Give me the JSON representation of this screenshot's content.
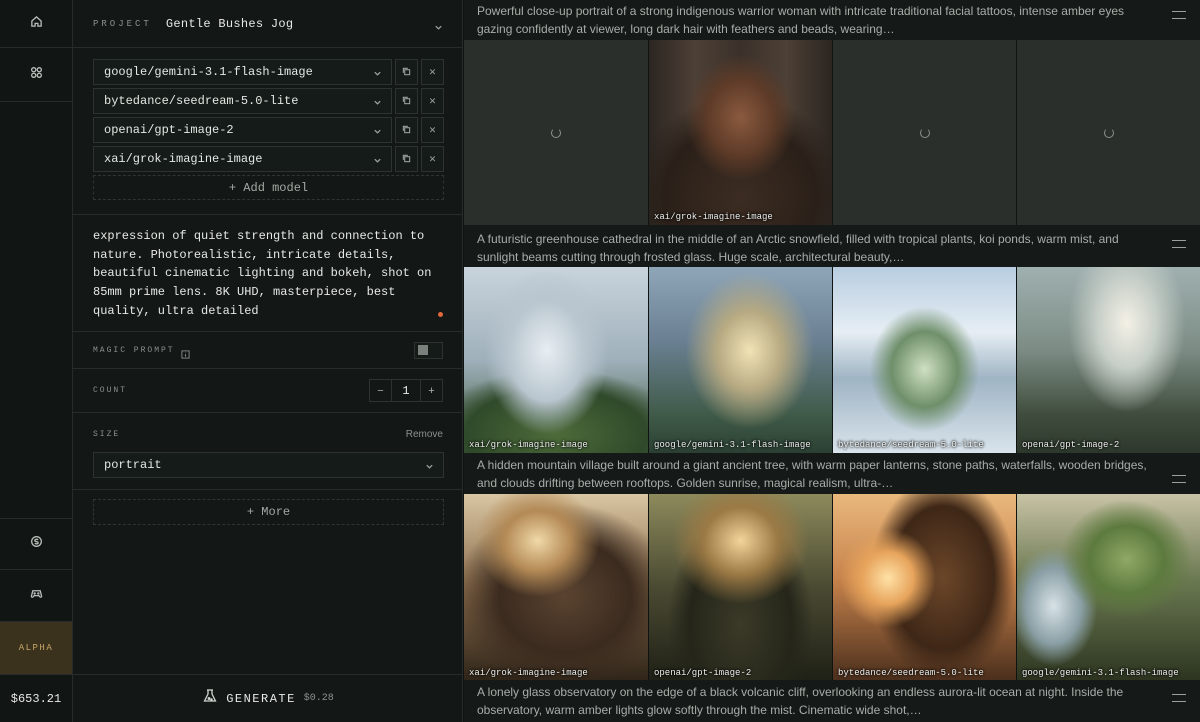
{
  "rail": {
    "alpha_label": "ALPHA",
    "balance": "$653.21",
    "icons": [
      "home-icon",
      "grid-icon",
      "coin-icon",
      "gamepad-icon"
    ]
  },
  "project": {
    "label": "PROJECT",
    "name": "Gentle Bushes Jog"
  },
  "models": [
    {
      "name": "google/gemini-3.1-flash-image"
    },
    {
      "name": "bytedance/seedream-5.0-lite"
    },
    {
      "name": "openai/gpt-image-2"
    },
    {
      "name": "xai/grok-imagine-image"
    }
  ],
  "add_model_label": "+ Add model",
  "prompt_text": "expression of quiet strength and connection to nature. Photorealistic, intricate details, beautiful cinematic lighting and bokeh, shot on 85mm prime lens. 8K UHD, masterpiece, best quality, ultra detailed",
  "magic_prompt": {
    "label": "MAGIC PROMPT",
    "enabled": false
  },
  "count": {
    "label": "COUNT",
    "value": "1",
    "minus": "−",
    "plus": "+"
  },
  "size": {
    "label": "SIZE",
    "remove_label": "Remove",
    "value": "portrait"
  },
  "more_label": "+ More",
  "generate": {
    "label": "GENERATE",
    "cost": "$0.28"
  },
  "colors": {
    "accent_dot": "#e0673a",
    "alpha_bg": "#3a321c",
    "alpha_text": "#c9a86a"
  },
  "gallery": [
    {
      "caption": "Powerful close-up portrait of a strong indigenous warrior woman with intricate traditional facial tattoos, intense amber eyes gazing confidently at viewer, long dark hair with feathers and beads, wearing…",
      "tiles": [
        {
          "status": "loading",
          "model": ""
        },
        {
          "status": "done",
          "model": "xai/grok-imagine-image"
        },
        {
          "status": "loading",
          "model": ""
        },
        {
          "status": "loading",
          "model": ""
        }
      ]
    },
    {
      "caption": "A futuristic greenhouse cathedral in the middle of an Arctic snowfield, filled with tropical plants, koi ponds, warm mist, and sunlight beams cutting through frosted glass. Huge scale, architectural beauty,…",
      "tiles": [
        {
          "status": "done",
          "model": "xai/grok-imagine-image"
        },
        {
          "status": "done",
          "model": "google/gemini-3.1-flash-image"
        },
        {
          "status": "done",
          "model": "bytedance/seedream-5.0-lite"
        },
        {
          "status": "done",
          "model": "openai/gpt-image-2"
        }
      ]
    },
    {
      "caption": "A hidden mountain village built around a giant ancient tree, with warm paper lanterns, stone paths, waterfalls, wooden bridges, and clouds drifting between rooftops. Golden sunrise, magical realism, ultra-…",
      "tiles": [
        {
          "status": "done",
          "model": "xai/grok-imagine-image"
        },
        {
          "status": "done",
          "model": "openai/gpt-image-2"
        },
        {
          "status": "done",
          "model": "bytedance/seedream-5.0-lite"
        },
        {
          "status": "done",
          "model": "google/gemini-3.1-flash-image"
        }
      ]
    },
    {
      "caption": "A lonely glass observatory on the edge of a black volcanic cliff, overlooking an endless aurora-lit ocean at night. Inside the observatory, warm amber lights glow softly through the mist. Cinematic wide shot,…",
      "tiles": []
    }
  ]
}
